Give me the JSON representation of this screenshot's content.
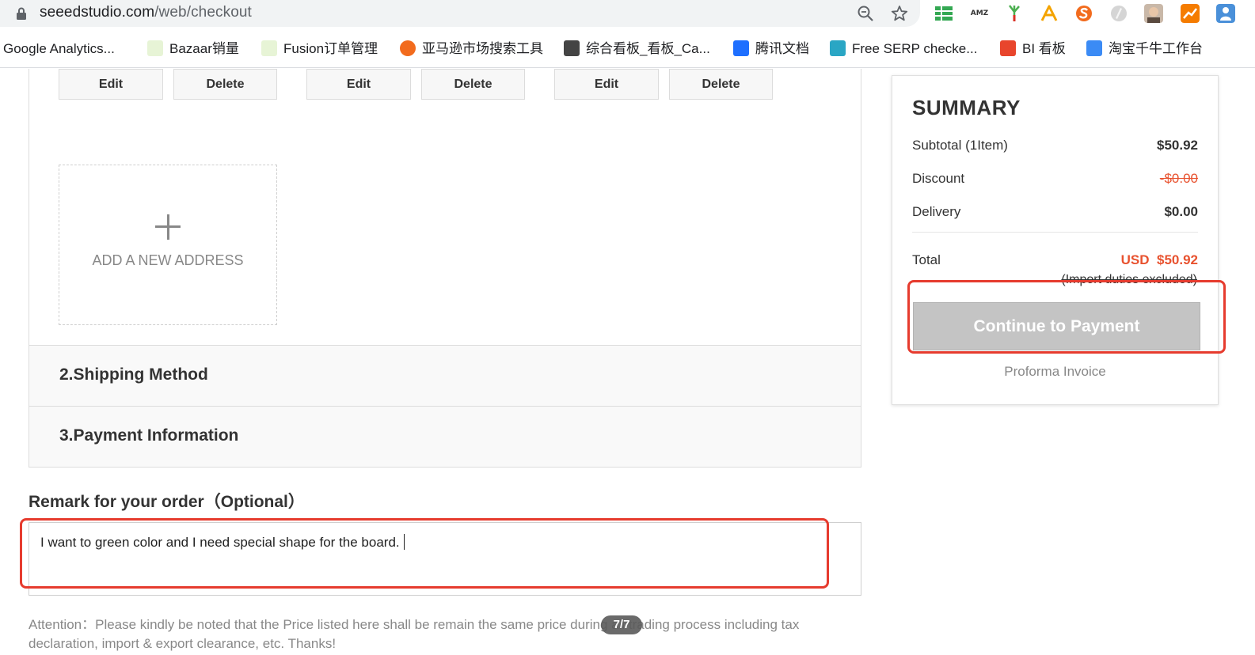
{
  "browser": {
    "url_host": "seeedstudio.com",
    "url_path": "/web/checkout",
    "icons": [
      "zoom-icon",
      "bookmark-star-icon"
    ],
    "extension_icons": [
      {
        "name": "sheets-extension-icon",
        "color": "#34a853"
      },
      {
        "name": "amz-extension-icon",
        "color": "#333333",
        "label": "AMZ"
      },
      {
        "name": "leek-extension-icon",
        "color": "#d93025"
      },
      {
        "name": "a-extension-icon",
        "color": "#f4a300"
      },
      {
        "name": "s-extension-icon",
        "color": "#f26b1d"
      },
      {
        "name": "gray-extension-icon",
        "color": "#c8c8c8"
      },
      {
        "name": "avatar-extension-icon",
        "color": "#8a6a55"
      },
      {
        "name": "analytics-extension-icon",
        "color": "#f57c00"
      },
      {
        "name": "person-extension-icon",
        "color": "#4a90d9"
      }
    ],
    "bookmarks": [
      {
        "label": "Google Analytics...",
        "fav": "none"
      },
      {
        "label": "Bazaar销量",
        "fav": "#7bbf3a"
      },
      {
        "label": "Fusion订单管理",
        "fav": "#7bbf3a"
      },
      {
        "label": "亚马逊市场搜索工具",
        "fav": "#f26b1d"
      },
      {
        "label": "综合看板_看板_Ca...",
        "fav": "#333333"
      },
      {
        "label": "腾讯文档",
        "fav": "#1e6fff"
      },
      {
        "label": "Free SERP checke...",
        "fav": "#2aa6c4"
      },
      {
        "label": "BI 看板",
        "fav": "#e8452c"
      },
      {
        "label": "淘宝千牛工作台",
        "fav": "#3b8bf5"
      }
    ]
  },
  "address": {
    "buttons": [
      {
        "label": "Edit"
      },
      {
        "label": "Delete"
      },
      {
        "label": "Edit"
      },
      {
        "label": "Delete"
      },
      {
        "label": "Edit"
      },
      {
        "label": "Delete"
      }
    ],
    "add_label": "ADD A NEW ADDRESS"
  },
  "sections": {
    "shipping": "2.Shipping Method",
    "payment": "3.Payment Information"
  },
  "remark": {
    "title": "Remark for your order（Optional）",
    "value": "I want to green color and I need special shape for the board."
  },
  "attention": "Attention：Please kindly be noted that the Price listed here shall be remain the same price during all trading process including tax declaration, import & export clearance, etc. Thanks!",
  "page_indicator": "7/7",
  "summary": {
    "title": "SUMMARY",
    "subtotal_label": "Subtotal (1Item)",
    "subtotal_value": "$50.92",
    "discount_label": "Discount",
    "discount_value": "-$0.00",
    "delivery_label": "Delivery",
    "delivery_value": "$0.00",
    "total_label": "Total",
    "total_value": "USD  $50.92",
    "duties_note": "(Import duties excluded)",
    "pay_button": "Continue to Payment",
    "proforma": "Proforma Invoice"
  },
  "colors": {
    "accent_red": "#e8522f",
    "highlight": "#e63b2e",
    "disabled_button": "#c4c4c4"
  }
}
